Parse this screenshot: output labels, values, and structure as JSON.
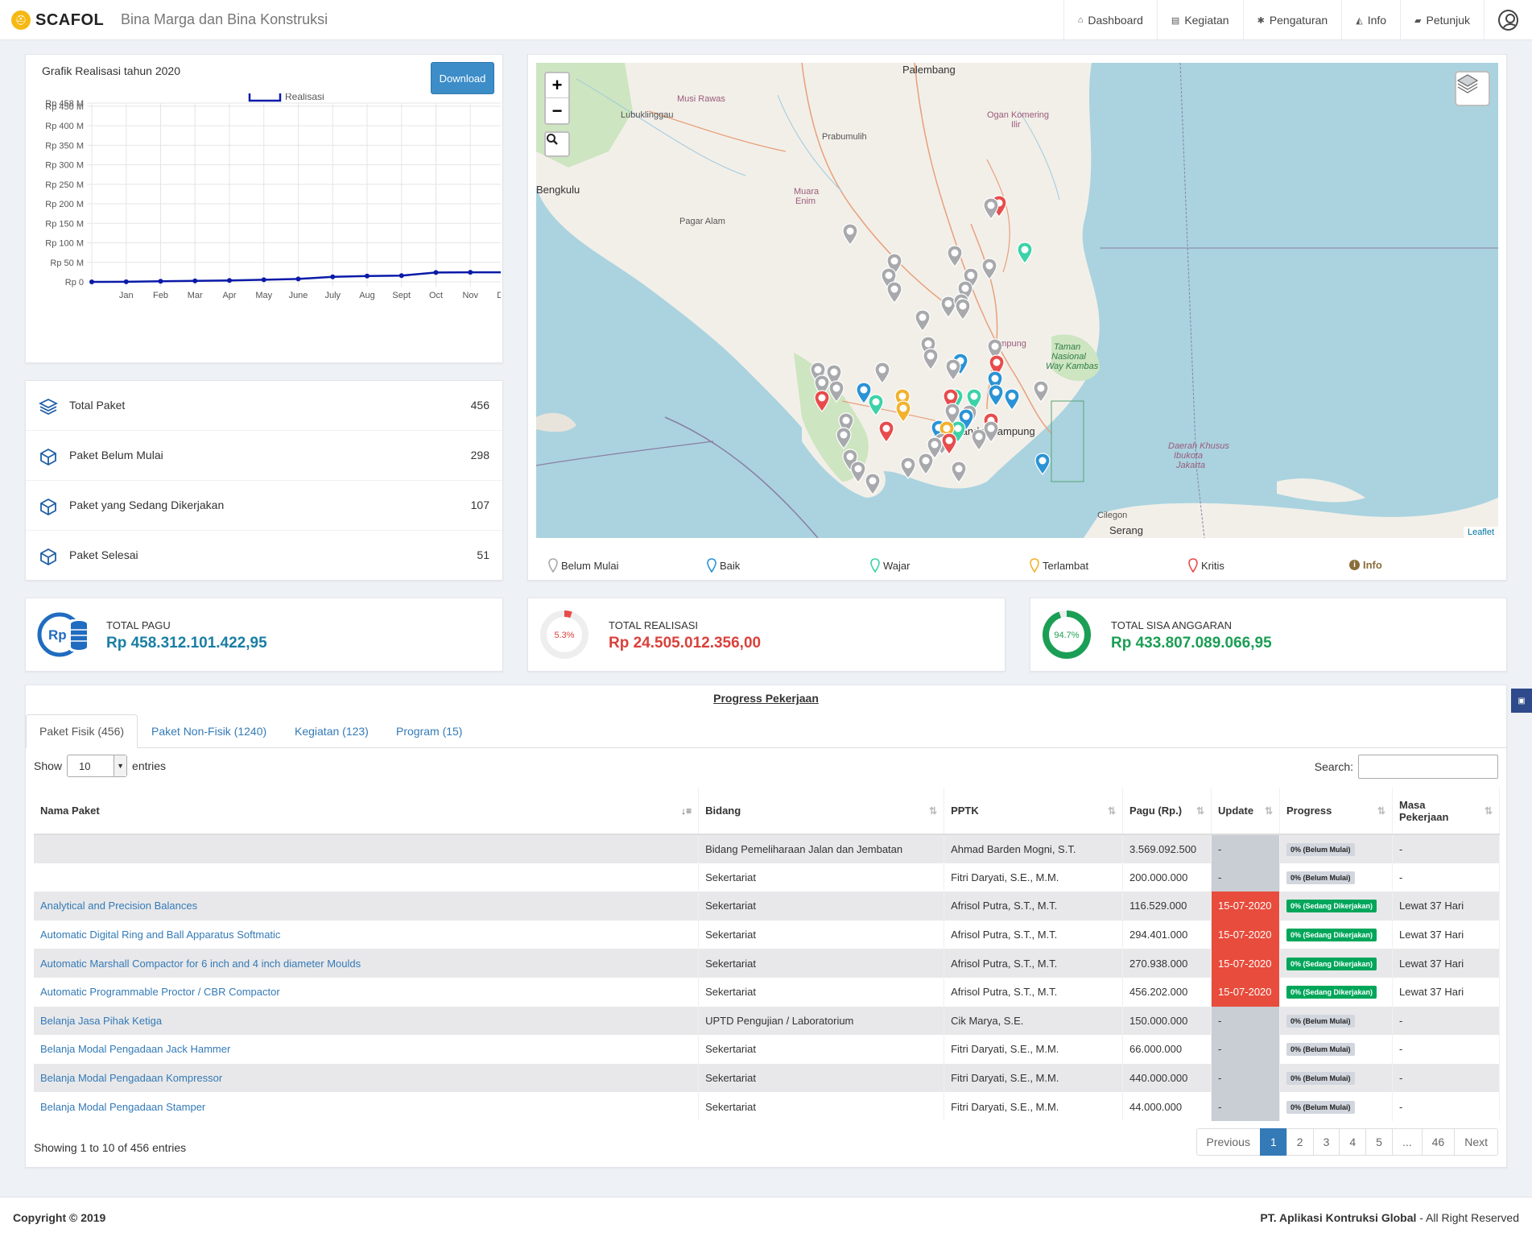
{
  "app": {
    "logo": "SCAFOL",
    "subtitle": "Bina Marga dan Bina Konstruksi"
  },
  "nav": [
    {
      "label": "Dashboard",
      "icon": "home-icon"
    },
    {
      "label": "Kegiatan",
      "icon": "file-icon"
    },
    {
      "label": "Pengaturan",
      "icon": "gear-icon"
    },
    {
      "label": "Info",
      "icon": "bell-icon"
    },
    {
      "label": "Petunjuk",
      "icon": "book-icon"
    }
  ],
  "chart_panel": {
    "title": "Grafik Realisasi tahun 2020",
    "download_label": "Download"
  },
  "chart_data": {
    "type": "line",
    "title": "",
    "legend": [
      "Realisasi"
    ],
    "legend_position": "top-center",
    "categories": [
      "",
      "Jan",
      "Feb",
      "Mar",
      "Apr",
      "May",
      "June",
      "July",
      "Aug",
      "Sept",
      "Oct",
      "Nov",
      "Dec"
    ],
    "yticks": [
      "Rp 0",
      "Rp 50 M",
      "Rp 100 M",
      "Rp 150 M",
      "Rp 200 M",
      "Rp 250 M",
      "Rp 300 M",
      "Rp 350 M",
      "Rp 400 M",
      "Rp 450 M",
      "Rp 458 M"
    ],
    "ylim": [
      0,
      458
    ],
    "grid": true,
    "series": [
      {
        "name": "Realisasi",
        "color": "#0a1aa8",
        "values": [
          0,
          0.3,
          1.5,
          2.5,
          3.5,
          5.5,
          7.5,
          13,
          15,
          16,
          24,
          24.5,
          24.5
        ]
      }
    ]
  },
  "stats": [
    {
      "label": "Total Paket",
      "value": "456"
    },
    {
      "label": "Paket Belum Mulai",
      "value": "298"
    },
    {
      "label": "Paket yang Sedang Dikerjakan",
      "value": "107"
    },
    {
      "label": "Paket Selesai",
      "value": "51"
    }
  ],
  "map": {
    "labels": {
      "palembang": "Palembang",
      "musi_rawas": "Musi Rawas",
      "lubuklinggau": "Lubuklinggau",
      "prabumulih": "Prabumulih",
      "ogan": "Ogan Komering",
      "ogan2": "Ilir",
      "bengkulu": "Bengkulu",
      "muara": "Muara",
      "enim": "Enim",
      "pagar_alam": "Pagar Alam",
      "lampung": "Lampung",
      "taman": "Taman",
      "nasional": "Nasional",
      "way_kambas": "Way Kambas",
      "lampung_city": "Bandar Lampung",
      "dki": "Daerah Khusus",
      "dki2": "Ibukota",
      "dki3": "Jakarta",
      "cilegon": "Cilegon",
      "serang": "Serang"
    },
    "attribution": "Leaflet",
    "zoom_in": "+",
    "zoom_out": "−"
  },
  "legend": [
    {
      "label": "Belum Mulai",
      "color": "#a7a9ac"
    },
    {
      "label": "Baik",
      "color": "#2a93d6"
    },
    {
      "label": "Wajar",
      "color": "#3cd2a8"
    },
    {
      "label": "Terlambat",
      "color": "#f1b22c"
    },
    {
      "label": "Kritis",
      "color": "#e84b4b"
    },
    {
      "label": "Info",
      "color": "#8a6d3b"
    }
  ],
  "summary": [
    {
      "label": "TOTAL PAGU",
      "value": "Rp 458.312.101.422,95",
      "color": "#1a7ea4"
    },
    {
      "label": "TOTAL REALISASI",
      "value": "Rp 24.505.012.356,00",
      "color": "#d9413b",
      "percent": "5.3%",
      "fraction": 0.053
    },
    {
      "label": "TOTAL SISA ANGGARAN",
      "value": "Rp 433.807.089.066,95",
      "color": "#1b9e55",
      "percent": "94.7%",
      "fraction": 0.947
    }
  ],
  "progress": {
    "title": "Progress Pekerjaan",
    "tabs": [
      "Paket Fisik (456)",
      "Paket Non-Fisik (1240)",
      "Kegiatan (123)",
      "Program (15)"
    ],
    "show_label": "Show",
    "entries_label": "entries",
    "page_size": "10",
    "search_label": "Search:",
    "columns": [
      "Nama Paket",
      "Bidang",
      "PPTK",
      "Pagu (Rp.)",
      "Update",
      "Progress",
      "Masa Pekerjaan"
    ],
    "rows": [
      {
        "nama": "",
        "bidang": "Bidang Pemeliharaan Jalan dan Jembatan",
        "pptk": "Ahmad Barden Mogni, S.T.",
        "pagu": "3.569.092.500",
        "update": "-",
        "progress": "0% (Belum Mulai)",
        "masa": "-"
      },
      {
        "nama": "",
        "bidang": "Sekertariat",
        "pptk": "Fitri Daryati, S.E., M.M.",
        "pagu": "200.000.000",
        "update": "-",
        "progress": "0% (Belum Mulai)",
        "masa": "-"
      },
      {
        "nama": "Analytical and Precision Balances",
        "bidang": "Sekertariat",
        "pptk": "Afrisol Putra, S.T., M.T.",
        "pagu": "116.529.000",
        "update": "15-07-2020",
        "progress": "0% (Sedang Dikerjakan)",
        "masa": "Lewat 37 Hari"
      },
      {
        "nama": "Automatic Digital Ring and Ball Apparatus Softmatic",
        "bidang": "Sekertariat",
        "pptk": "Afrisol Putra, S.T., M.T.",
        "pagu": "294.401.000",
        "update": "15-07-2020",
        "progress": "0% (Sedang Dikerjakan)",
        "masa": "Lewat 37 Hari"
      },
      {
        "nama": "Automatic Marshall Compactor for 6 inch and 4 inch diameter Moulds",
        "bidang": "Sekertariat",
        "pptk": "Afrisol Putra, S.T., M.T.",
        "pagu": "270.938.000",
        "update": "15-07-2020",
        "progress": "0% (Sedang Dikerjakan)",
        "masa": "Lewat 37 Hari"
      },
      {
        "nama": "Automatic Programmable Proctor / CBR Compactor",
        "bidang": "Sekertariat",
        "pptk": "Afrisol Putra, S.T., M.T.",
        "pagu": "456.202.000",
        "update": "15-07-2020",
        "progress": "0% (Sedang Dikerjakan)",
        "masa": "Lewat 37 Hari"
      },
      {
        "nama": "Belanja Jasa Pihak Ketiga",
        "bidang": "UPTD Pengujian / Laboratorium",
        "pptk": "Cik Marya, S.E.",
        "pagu": "150.000.000",
        "update": "-",
        "progress": "0% (Belum Mulai)",
        "masa": "-"
      },
      {
        "nama": "Belanja Modal Pengadaan Jack Hammer",
        "bidang": "Sekertariat",
        "pptk": "Fitri Daryati, S.E., M.M.",
        "pagu": "66.000.000",
        "update": "-",
        "progress": "0% (Belum Mulai)",
        "masa": "-"
      },
      {
        "nama": "Belanja Modal Pengadaan Kompressor",
        "bidang": "Sekertariat",
        "pptk": "Fitri Daryati, S.E., M.M.",
        "pagu": "440.000.000",
        "update": "-",
        "progress": "0% (Belum Mulai)",
        "masa": "-"
      },
      {
        "nama": "Belanja Modal Pengadaan Stamper",
        "bidang": "Sekertariat",
        "pptk": "Fitri Daryati, S.E., M.M.",
        "pagu": "44.000.000",
        "update": "-",
        "progress": "0% (Belum Mulai)",
        "masa": "-"
      }
    ],
    "info": "Showing 1 to 10 of 456 entries",
    "pagination": [
      "Previous",
      "1",
      "2",
      "3",
      "4",
      "5",
      "...",
      "46",
      "Next"
    ]
  },
  "footer": {
    "copyright": "Copyright © 2019",
    "company": "PT. Aplikasi Kontruksi Global",
    "rights": " - All Right Reserved"
  }
}
